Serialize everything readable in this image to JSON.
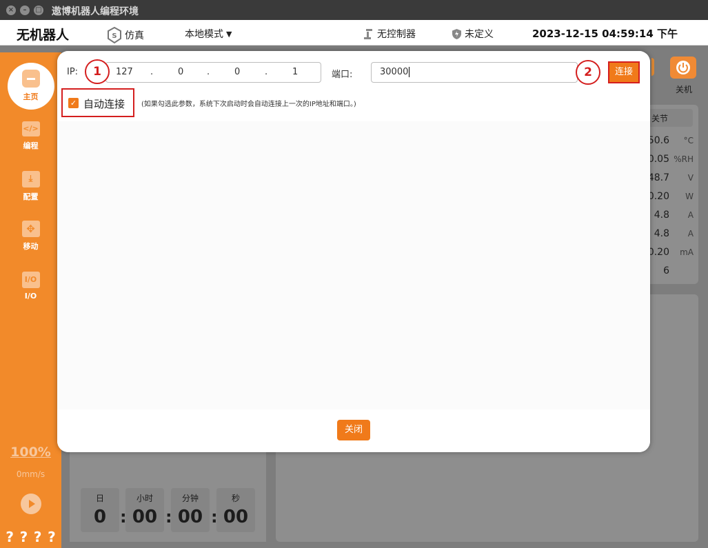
{
  "os": {
    "title": "遨博机器人编程环境"
  },
  "header": {
    "app_name": "无机器人",
    "sim_label": "仿真",
    "mode_label": "本地模式",
    "controller_label": "无控制器",
    "safety_label": "未定义",
    "datetime": "2023-12-15 04:59:14 下午"
  },
  "sidebar": {
    "items": [
      {
        "label": "主页",
        "icon": "home-icon"
      },
      {
        "label": "编程",
        "icon": "code-icon"
      },
      {
        "label": "配置",
        "icon": "config-icon"
      },
      {
        "label": "移动",
        "icon": "move-icon"
      },
      {
        "label": "I/O",
        "icon": "io-icon"
      }
    ],
    "speed_pct": "100%",
    "speed_mm": "0mm/s",
    "qmarks": [
      "?",
      "?",
      "?",
      "?"
    ]
  },
  "background": {
    "poweroff_label": "关机",
    "joint_tab": "关节",
    "readings": [
      {
        "value": "50.6",
        "unit": "°C"
      },
      {
        "value": "0.05",
        "unit": "%RH"
      },
      {
        "value": "48.7",
        "unit": "V"
      },
      {
        "value": "0.20",
        "unit": "W"
      },
      {
        "value": "4.8",
        "unit": "A"
      },
      {
        "value": "4.8",
        "unit": "A"
      },
      {
        "value": "0.20",
        "unit": "mA"
      },
      {
        "value": "6",
        "unit": ""
      }
    ],
    "timer": [
      {
        "label": "日",
        "value": "0"
      },
      {
        "label": "小时",
        "value": "00"
      },
      {
        "label": "分钟",
        "value": "00"
      },
      {
        "label": "秒",
        "value": "00"
      }
    ]
  },
  "modal": {
    "ip_label": "IP:",
    "ip": [
      "127",
      "0",
      "0",
      "1"
    ],
    "ip_dot": ".",
    "port_label": "端口:",
    "port_value": "30000",
    "connect_label": "连接",
    "auto_connect_label": "自动连接",
    "auto_connect_checked": true,
    "hint": "(如果勾选此参数，系统下次启动时会自动连接上一次的IP地址和端口。)",
    "close_label": "关闭",
    "badge_1": "1",
    "badge_2": "2"
  },
  "colors": {
    "accent": "#f07a1a",
    "highlight": "#d41e1e"
  }
}
